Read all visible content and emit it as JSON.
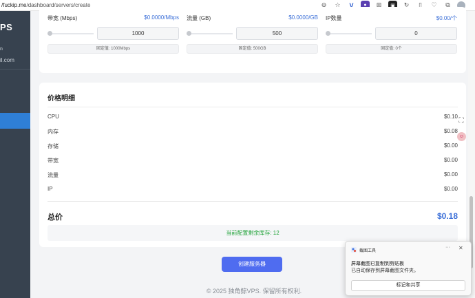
{
  "browser": {
    "url_prefix": "/fuckip.me",
    "url_path": "/dashboard/servers/create"
  },
  "sidebar": {
    "title": "PS",
    "user_line": "n",
    "email_line": "il.com"
  },
  "resources": [
    {
      "label": "带宽 (Mbps)",
      "price": "$0.0000/Mbps",
      "value": "1000",
      "fixed_note": "固定值: 1000Mbps"
    },
    {
      "label": "流量 (GB)",
      "price": "$0.0000/GB",
      "value": "500",
      "fixed_note": "固定值: 500GB"
    },
    {
      "label": "IP数量",
      "price": "$0.00/个",
      "value": "0",
      "fixed_note": "固定值: 0个"
    }
  ],
  "price_detail": {
    "title": "价格明细",
    "rows": [
      {
        "label": "CPU",
        "value": "$0.10"
      },
      {
        "label": "内存",
        "value": "$0.08"
      },
      {
        "label": "存储",
        "value": "$0.00"
      },
      {
        "label": "带宽",
        "value": "$0.00"
      },
      {
        "label": "流量",
        "value": "$0.00"
      },
      {
        "label": "IP",
        "value": "$0.00"
      }
    ],
    "total_label": "总价",
    "total_value": "$0.18",
    "stock_text": "当前配置剩余库存: 12"
  },
  "create_button": "创建服务器",
  "footer": "© 2025 独角鲸VPS. 保留所有权利.",
  "toast": {
    "app": "截图工具",
    "more": "···",
    "close": "✕",
    "title": "屏幕截图已复制到剪贴板",
    "body": "已自动保存到屏幕截图文件夹。",
    "button": "标记和共享"
  },
  "colors": {
    "sidebar_bg": "#37424f",
    "sidebar_active": "#2f7fd6",
    "accent_blue": "#3b6fd8",
    "button_blue": "#4f6cf0",
    "stock_green": "#22a33a"
  }
}
